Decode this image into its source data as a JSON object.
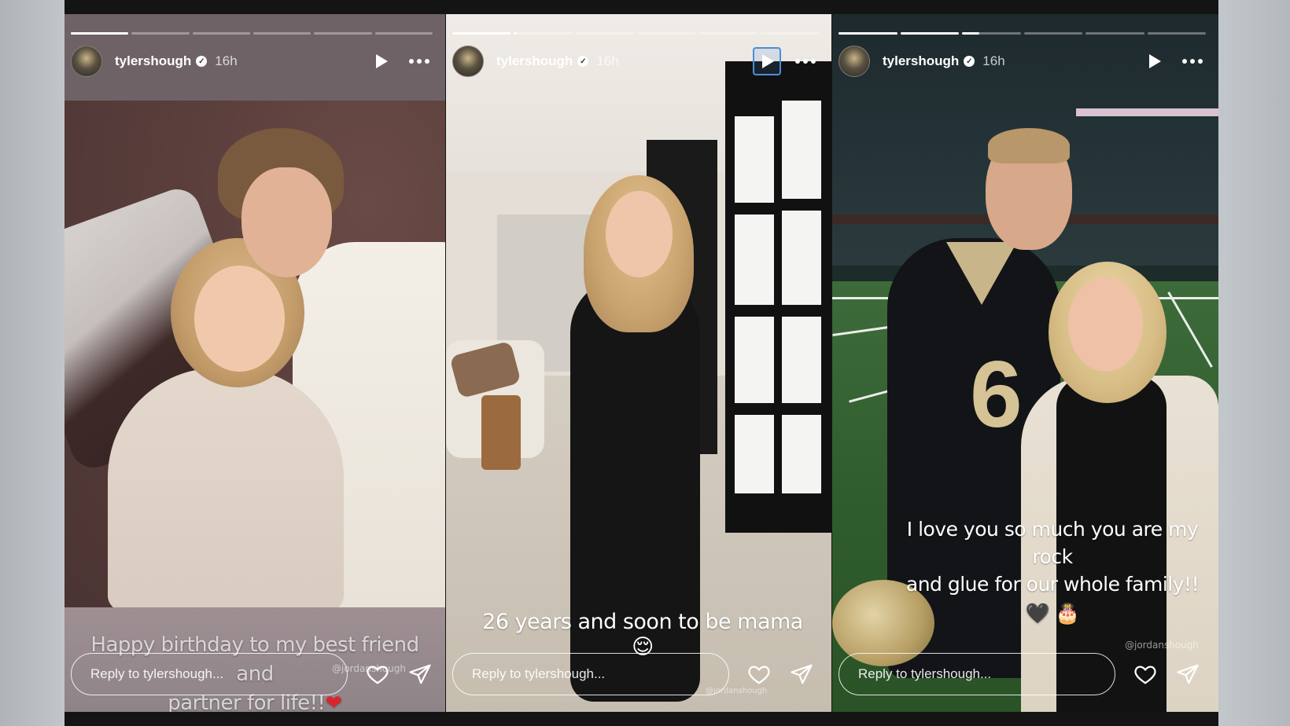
{
  "stories": [
    {
      "username": "tylershough",
      "time": "16h",
      "progress": [
        1,
        0,
        0,
        0,
        0,
        0
      ],
      "caption_lines": [
        "Happy birthday to my best friend and",
        "partner for life!!"
      ],
      "caption_emoji": "❤",
      "mention": "@jordanshough",
      "reply_placeholder": "Reply to tylershough..."
    },
    {
      "username": "tylershough",
      "time": "16h",
      "progress": [
        1,
        0.05,
        0,
        0,
        0,
        0
      ],
      "caption_lines": [
        "26 years and soon to be mama"
      ],
      "caption_emoji": "😌",
      "mention": "@jordanshough",
      "reply_placeholder": "Reply to tylershough..."
    },
    {
      "username": "tylershough",
      "time": "16h",
      "progress": [
        1,
        1,
        0.3,
        0,
        0,
        0
      ],
      "caption_lines": [
        "I love you so much you are my rock",
        "and glue for our whole family!!"
      ],
      "caption_emoji": "🖤 🎂",
      "mention": "@jordanshough",
      "reply_placeholder": "Reply to tylershough..."
    }
  ],
  "icons": {
    "verified": "verified-badge-icon",
    "play": "play-icon",
    "more": "more-icon",
    "like": "heart-icon",
    "share": "send-icon"
  },
  "colors": {
    "focus_ring": "#4a8fd9",
    "frame": "#141414"
  }
}
